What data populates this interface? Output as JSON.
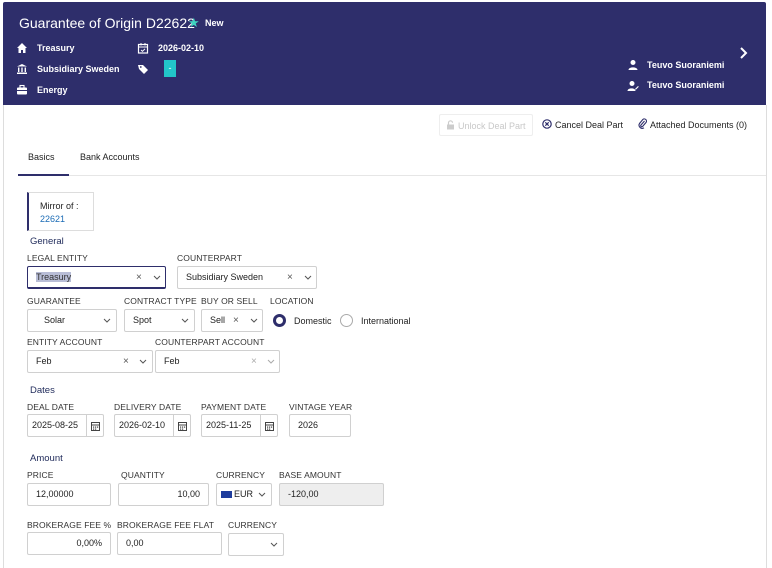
{
  "header": {
    "title": "Guarantee of Origin D22622",
    "status": "New",
    "portfolio": "Treasury",
    "entity": "Subsidiary Sweden",
    "category": "Energy",
    "date": "2026-02-10",
    "tag": "-",
    "trader": "Teuvo Suoraniemi",
    "counterpart_user": "Teuvo Suoraniemi",
    "accent_color": "#3fd3c0",
    "bg_color": "#2e2e6b"
  },
  "toolbar": {
    "unlock_label": "Unlock Deal Part",
    "cancel_label": "Cancel Deal Part",
    "attached_label": "Attached Documents (0)"
  },
  "tabs": [
    {
      "label": "Basics",
      "active": true
    },
    {
      "label": "Bank Accounts",
      "active": false
    }
  ],
  "mirror": {
    "label": "Mirror of :",
    "value": "22621"
  },
  "general": {
    "heading": "General",
    "legal_entity_label": "LEGAL ENTITY",
    "legal_entity_value": "Treasury",
    "counterpart_label": "COUNTERPART",
    "counterpart_value": "Subsidiary Sweden",
    "guarantee_label": "GUARANTEE",
    "guarantee_value": "Solar",
    "contract_type_label": "CONTRACT TYPE",
    "contract_type_value": "Spot",
    "buy_sell_label": "BUY OR SELL",
    "buy_sell_value": "Sell",
    "location_label": "LOCATION",
    "location_options": [
      "Domestic",
      "International"
    ],
    "location_selected": "Domestic",
    "entity_account_label": "ENTITY ACCOUNT",
    "entity_account_value": "Feb",
    "counterpart_account_label": "COUNTERPART ACCOUNT",
    "counterpart_account_value": "Feb"
  },
  "dates": {
    "heading": "Dates",
    "deal_date_label": "DEAL DATE",
    "deal_date_value": "2025-08-25",
    "delivery_date_label": "DELIVERY DATE",
    "delivery_date_value": "2026-02-10",
    "payment_date_label": "PAYMENT DATE",
    "payment_date_value": "2025-11-25",
    "vintage_year_label": "VINTAGE YEAR",
    "vintage_year_value": "2026"
  },
  "amount": {
    "heading": "Amount",
    "price_label": "PRICE",
    "price_value": "12,00000",
    "quantity_label": "QUANTITY",
    "quantity_value": "10,00",
    "currency_label": "CURRENCY",
    "currency_value": "EUR",
    "base_amount_label": "BASE AMOUNT",
    "base_amount_value": "-120,00",
    "brokerage_fee_pct_label": "BROKERAGE FEE %",
    "brokerage_fee_pct_value": "0,00%",
    "brokerage_fee_flat_label": "BROKERAGE FEE FLAT",
    "brokerage_fee_flat_value": "0,00",
    "brokerage_currency_label": "CURRENCY",
    "brokerage_currency_value": ""
  }
}
